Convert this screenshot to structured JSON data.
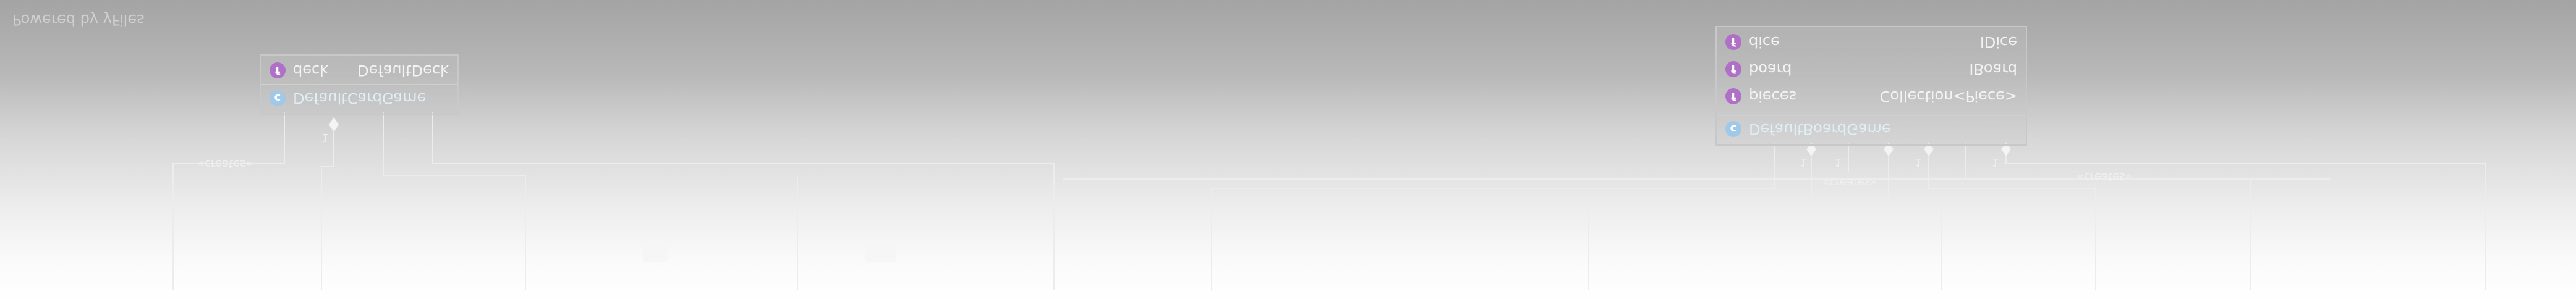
{
  "watermark": "Powered by yFiles",
  "classes": [
    {
      "id": "default-card-game",
      "name": "DefaultCardGame",
      "fields": [
        {
          "name": "deck",
          "type": "DefaultDeck"
        }
      ]
    },
    {
      "id": "default-board-game",
      "name": "DefaultBoardGame",
      "fields": [
        {
          "name": "dice",
          "type": "IDice"
        },
        {
          "name": "board",
          "type": "IBoard"
        },
        {
          "name": "pieces",
          "type": "Collection<Piece>"
        }
      ]
    }
  ],
  "edge_labels": {
    "creates_left": "«creates»",
    "creates_middle": "«creates»",
    "creates_right": "«creates»",
    "multiplicity": "1"
  },
  "badges": {
    "field": "f",
    "class": "c"
  },
  "colors": {
    "line": "#e8e8e8",
    "field_badge": "#b070c8",
    "class_badge": "#a0c8e8"
  }
}
